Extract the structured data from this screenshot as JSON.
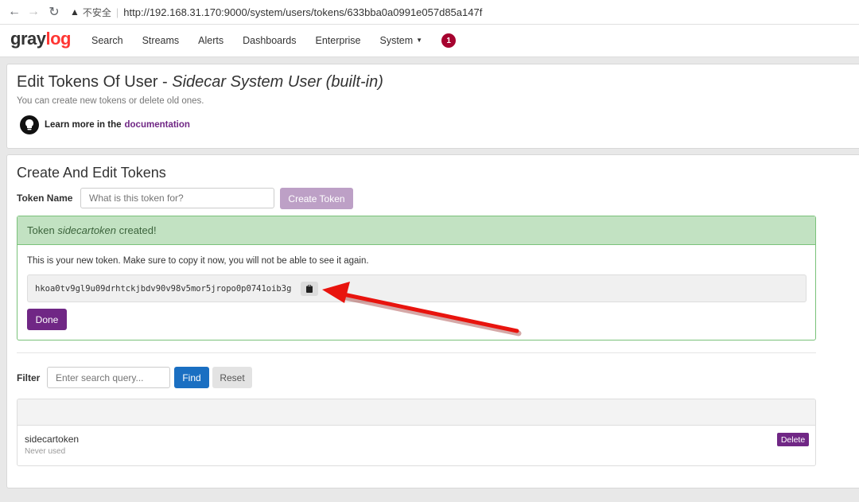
{
  "browser": {
    "insecure_label": "不安全",
    "url": "http://192.168.31.170:9000/system/users/tokens/633bba0a0991e057d85a147f"
  },
  "navbar": {
    "logo_gray": "gray",
    "logo_log": "log",
    "items": [
      "Search",
      "Streams",
      "Alerts",
      "Dashboards",
      "Enterprise",
      "System"
    ],
    "notification_count": "1"
  },
  "page": {
    "title_prefix": "Edit Tokens Of User - ",
    "title_user": "Sidecar System User (built-in)",
    "subtitle": "You can create new tokens or delete old ones.",
    "learn_more": "Learn more in the",
    "learn_link": "documentation"
  },
  "tokens": {
    "section_title": "Create And Edit Tokens",
    "name_label": "Token Name",
    "name_placeholder": "What is this token for?",
    "create_button": "Create Token",
    "success_prefix": "Token ",
    "success_name": "sidecartoken",
    "success_suffix": " created!",
    "new_token_message": "This is your new token. Make sure to copy it now, you will not be able to see it again.",
    "token_value": "hkoa0tv9gl9u09drhtckjbdv90v98v5mor5jropo0p0741oib3g",
    "done_button": "Done"
  },
  "filter": {
    "label": "Filter",
    "placeholder": "Enter search query...",
    "find_button": "Find",
    "reset_button": "Reset"
  },
  "token_list": [
    {
      "name": "sidecartoken",
      "status": "Never used",
      "delete_label": "Delete"
    }
  ],
  "colors": {
    "brand_purple": "#702785",
    "find_blue": "#1a6fc2",
    "success_green": "#c2e2c2",
    "annotation_red": "#e8140e"
  }
}
